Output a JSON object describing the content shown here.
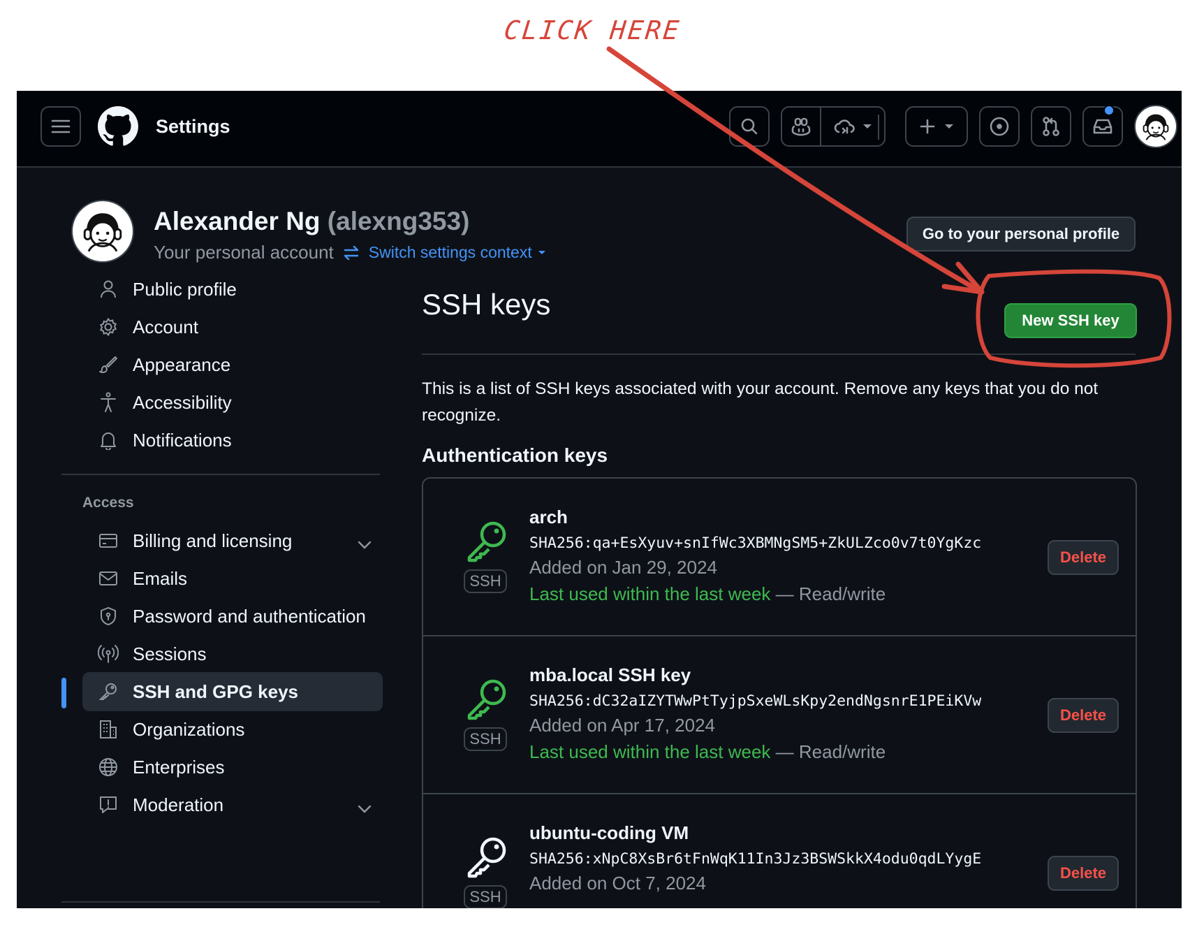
{
  "annotation": {
    "text": "CLICK HERE",
    "color": "#d6453a"
  },
  "topbar": {
    "title": "Settings",
    "menu_icon": "hamburger-icon",
    "logo_icon": "github-logo-icon",
    "buttons": [
      "search-icon",
      "copilot-icon",
      "copilot-cloud-icon",
      "plus-icon",
      "issues-icon",
      "pull-requests-icon",
      "inbox-icon"
    ],
    "has_notification": true
  },
  "header": {
    "name": "Alexander Ng",
    "handle": "(alexng353)",
    "subtitle": "Your personal account",
    "switch_context": "Switch settings context",
    "profile_button": "Go to your personal profile"
  },
  "sidebar": {
    "items": [
      {
        "label": "Public profile",
        "icon": "person-icon"
      },
      {
        "label": "Account",
        "icon": "gear-icon"
      },
      {
        "label": "Appearance",
        "icon": "paintbrush-icon"
      },
      {
        "label": "Accessibility",
        "icon": "accessibility-icon"
      },
      {
        "label": "Notifications",
        "icon": "bell-icon"
      }
    ],
    "access_heading": "Access",
    "access_items": [
      {
        "label": "Billing and licensing",
        "icon": "credit-card-icon",
        "expandable": true
      },
      {
        "label": "Emails",
        "icon": "mail-icon"
      },
      {
        "label": "Password and authentication",
        "icon": "shield-lock-icon"
      },
      {
        "label": "Sessions",
        "icon": "broadcast-icon"
      },
      {
        "label": "SSH and GPG keys",
        "icon": "key-icon",
        "active": true
      },
      {
        "label": "Organizations",
        "icon": "organization-icon"
      },
      {
        "label": "Enterprises",
        "icon": "globe-icon"
      },
      {
        "label": "Moderation",
        "icon": "report-icon",
        "expandable": true
      }
    ]
  },
  "main": {
    "title": "SSH keys",
    "new_button": "New SSH key",
    "description": "This is a list of SSH keys associated with your account. Remove any keys that you do not recognize.",
    "section_heading": "Authentication keys",
    "keys": [
      {
        "name": "arch",
        "fingerprint": "SHA256:qa+EsXyuv+snIfWc3XBMNgSM5+ZkULZco0v7t0YgKzc",
        "added": "Added on Jan 29, 2024",
        "last_used": "Last used within the last week",
        "access": "— Read/write",
        "badge": "SSH",
        "recent": true,
        "delete_label": "Delete"
      },
      {
        "name": "mba.local SSH key",
        "fingerprint": "SHA256:dC32aIZYTWwPtTyjpSxeWLsKpy2endNgsnrE1PEiKVw",
        "added": "Added on Apr 17, 2024",
        "last_used": "Last used within the last week",
        "access": "— Read/write",
        "badge": "SSH",
        "recent": true,
        "delete_label": "Delete"
      },
      {
        "name": "ubuntu-coding VM",
        "fingerprint": "SHA256:xNpC8XsBr6tFnWqK11In3Jz3BSWSkkX4odu0qdLYygE",
        "added": "Added on Oct 7, 2024",
        "badge": "SSH",
        "recent": false,
        "delete_label": "Delete"
      }
    ]
  },
  "colors": {
    "background": "#0d1117",
    "topbar": "#010409",
    "accent_blue": "#4493f8",
    "primary_green": "#238636",
    "recent_green": "#3fb950",
    "danger_red": "#f85149",
    "annotation_red": "#d6453a"
  }
}
